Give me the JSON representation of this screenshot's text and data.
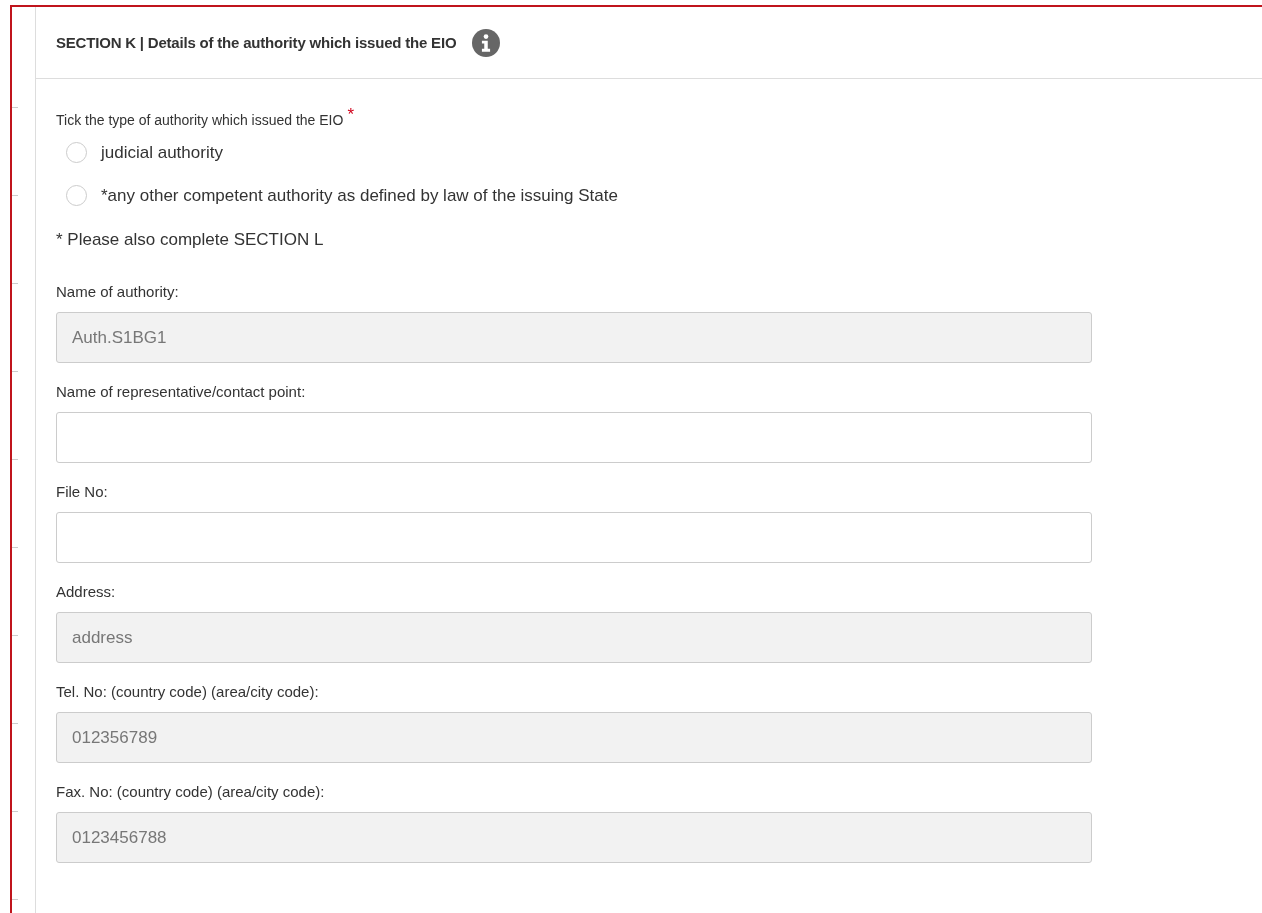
{
  "section": {
    "title": "SECTION K | Details of the authority which issued the EIO"
  },
  "authority_type": {
    "label": "Tick the type of authority which issued the EIO",
    "required": true,
    "required_mark": "*",
    "options": [
      {
        "label": "judicial authority",
        "selected": false
      },
      {
        "label": "*any other competent authority as defined by law of the issuing State",
        "selected": false
      }
    ]
  },
  "note": "* Please also complete SECTION L",
  "fields": [
    {
      "label": "Name of authority:",
      "value": "Auth.S1BG1",
      "disabled": true
    },
    {
      "label": "Name of representative/contact point:",
      "disabled": false
    },
    {
      "label": "File No:",
      "disabled": false
    },
    {
      "label": "Address:",
      "value": "address",
      "disabled": true
    },
    {
      "label": "Tel. No: (country code) (area/city code):",
      "value": "012356789",
      "disabled": true
    },
    {
      "label": "Fax. No: (country code) (area/city code):",
      "value": "0123456788",
      "disabled": true
    }
  ]
}
